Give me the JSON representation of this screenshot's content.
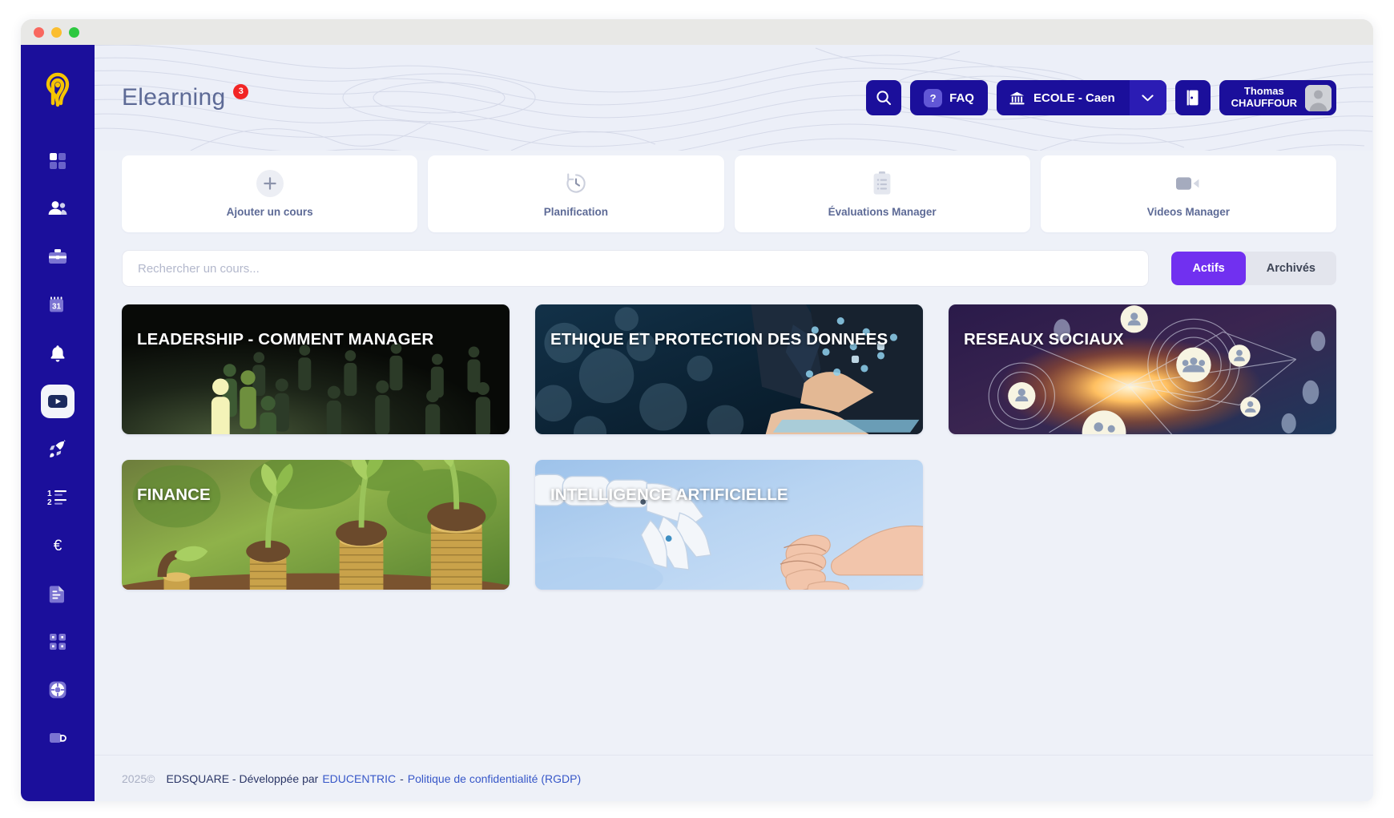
{
  "window": {
    "traffic_lights": [
      "close",
      "minimize",
      "maximize"
    ]
  },
  "header": {
    "title": "Elearning",
    "badge": "3",
    "search_icon": "search-icon",
    "faq_label": "FAQ",
    "faq_badge": "?",
    "school_label": "ECOLE - Caen",
    "school_icon": "bank-icon",
    "caret_icon": "chevron-down-icon",
    "logout_icon": "logout-door-icon",
    "user_firstname": "Thomas",
    "user_lastname": "CHAUFFOUR",
    "avatar_icon": "avatar-icon"
  },
  "sidebar": {
    "logo": "edsquare-logo",
    "items": [
      {
        "icon": "dashboard-grid-icon",
        "name": "dashboard",
        "active": false
      },
      {
        "icon": "users-icon",
        "name": "users",
        "active": false
      },
      {
        "icon": "briefcase-icon",
        "name": "jobs",
        "active": false
      },
      {
        "icon": "calendar-31-icon",
        "name": "calendar",
        "active": false
      },
      {
        "icon": "bell-icon",
        "name": "notifications",
        "active": false
      },
      {
        "icon": "video-play-icon",
        "name": "elearning",
        "active": true
      },
      {
        "icon": "rocket-icon",
        "name": "onboarding",
        "active": false
      },
      {
        "icon": "numbered-list-icon",
        "name": "rankings",
        "active": false
      },
      {
        "icon": "euro-icon",
        "name": "finance",
        "active": false
      },
      {
        "icon": "document-icon",
        "name": "documents",
        "active": false
      },
      {
        "icon": "apps-grid-icon",
        "name": "apps",
        "active": false
      },
      {
        "icon": "lifebuoy-icon",
        "name": "support",
        "active": false
      },
      {
        "icon": "coffee-mug-icon",
        "name": "break",
        "active": false
      }
    ],
    "calendar_day": "31",
    "list_numbers": [
      "1",
      "2"
    ],
    "euro_symbol": "€"
  },
  "quick_actions": [
    {
      "label": "Ajouter un cours",
      "icon": "plus-icon"
    },
    {
      "label": "Planification",
      "icon": "clock-rewind-icon"
    },
    {
      "label": "Évaluations Manager",
      "icon": "clipboard-icon"
    },
    {
      "label": "Videos Manager",
      "icon": "video-camera-icon"
    }
  ],
  "search": {
    "placeholder": "Rechercher un cours...",
    "value": ""
  },
  "tabs": [
    {
      "label": "Actifs",
      "active": true
    },
    {
      "label": "Archivés",
      "active": false
    }
  ],
  "courses": [
    {
      "title": "LEADERSHIP - COMMENT MANAGER",
      "art": "crowd-dark"
    },
    {
      "title": "ETHIQUE ET PROTECTION DES DONNEES",
      "art": "data-blue"
    },
    {
      "title": "RESEAUX SOCIAUX",
      "art": "network-purple"
    },
    {
      "title": "FINANCE",
      "art": "coins-plants"
    },
    {
      "title": "INTELLIGENCE ARTIFICIELLE",
      "art": "robot-hand"
    }
  ],
  "footer": {
    "year": "2025©",
    "company": "EDSQUARE - Développée par ",
    "developer": "EDUCENTRIC",
    "separator": " - ",
    "privacy": "Politique de confidentialité (RGDP)"
  },
  "colors": {
    "sidebar": "#1b0f9b",
    "accent_purple": "#7130f0",
    "badge_red": "#f22525",
    "logo_yellow": "#f5c400",
    "page_bg": "#eef1f8"
  }
}
